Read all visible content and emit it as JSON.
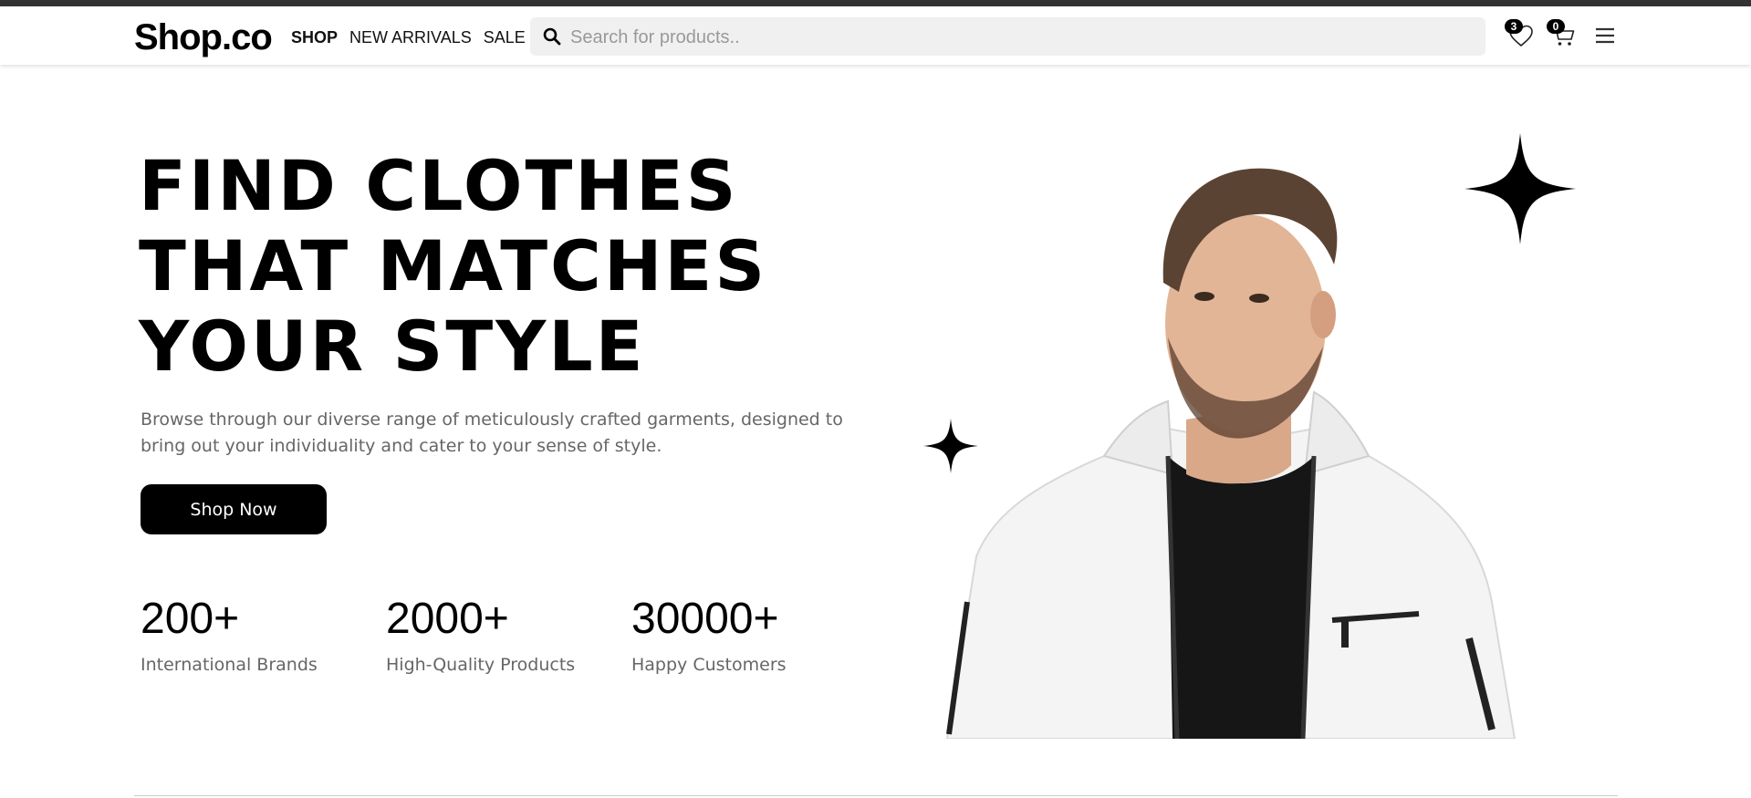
{
  "brand": {
    "logo": "Shop.co"
  },
  "nav": [
    {
      "label": "SHOP",
      "active": true
    },
    {
      "label": "NEW ARRIVALS",
      "active": false
    },
    {
      "label": "SALE",
      "active": false
    }
  ],
  "search": {
    "placeholder": "Search for products..",
    "value": "",
    "icon": "search-icon"
  },
  "header_actions": {
    "wishlist_count": "3",
    "cart_count": "0"
  },
  "hero": {
    "title_lines": [
      "FIND CLOTHES",
      "THAT MATCHES",
      "YOUR STYLE"
    ],
    "description": "Browse through our diverse range of meticulously crafted garments, designed to bring out your individuality and cater to your sense of style.",
    "cta_label": "Shop Now",
    "stats": [
      {
        "value": "200+",
        "label": "International Brands"
      },
      {
        "value": "2000+",
        "label": "High-Quality Products"
      },
      {
        "value": "30000+",
        "label": "Happy Customers"
      }
    ]
  },
  "colors": {
    "accent": "#000000",
    "topbar": "#333333",
    "search_bg": "#f0f0f0",
    "muted_text": "#666666"
  }
}
